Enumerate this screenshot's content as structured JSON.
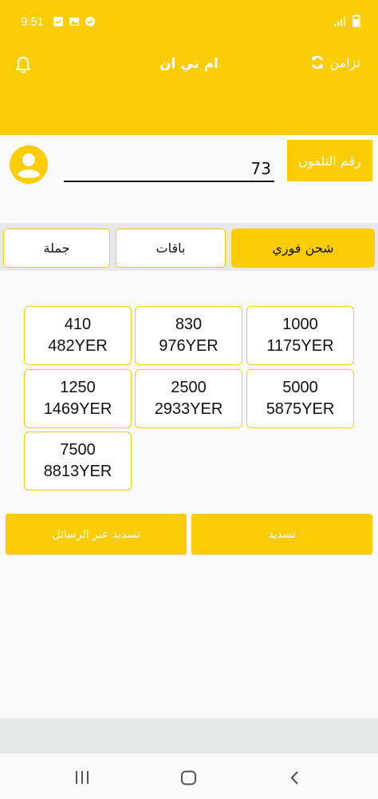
{
  "status_bar": {
    "time": "9:51",
    "icons_left": [
      "check-badge-icon",
      "image-icon",
      "check-circle-icon"
    ],
    "icons_right": [
      "signal-icon",
      "battery-icon"
    ]
  },
  "app_bar": {
    "title": "ام تي ان",
    "sync_label": "تزامن",
    "sync_icon": "refresh-icon",
    "bell_icon": "bell-icon"
  },
  "phone": {
    "value": "73",
    "label_button": "رقم التلفون",
    "avatar_icon": "user-avatar-icon"
  },
  "tabs": [
    {
      "label": "شحن فوري",
      "active": true
    },
    {
      "label": "باقات",
      "active": false
    },
    {
      "label": "جملة",
      "active": false
    }
  ],
  "amounts": [
    {
      "units": "1000",
      "price": "1175YER"
    },
    {
      "units": "830",
      "price": "976YER"
    },
    {
      "units": "410",
      "price": "482YER"
    },
    {
      "units": "5000",
      "price": "5875YER"
    },
    {
      "units": "2500",
      "price": "2933YER"
    },
    {
      "units": "1250",
      "price": "1469YER"
    },
    {
      "units": "7500",
      "price": "8813YER"
    }
  ],
  "actions": {
    "pay": "تسديد",
    "pay_sms": "تسديد عبر الرسائل"
  },
  "nav": {
    "recents_icon": "recents-icon",
    "home_icon": "home-icon",
    "back_icon": "back-icon"
  },
  "colors": {
    "accent": "#fccd04",
    "tab_strip": "#e8e8e8",
    "background": "#fafafa"
  }
}
